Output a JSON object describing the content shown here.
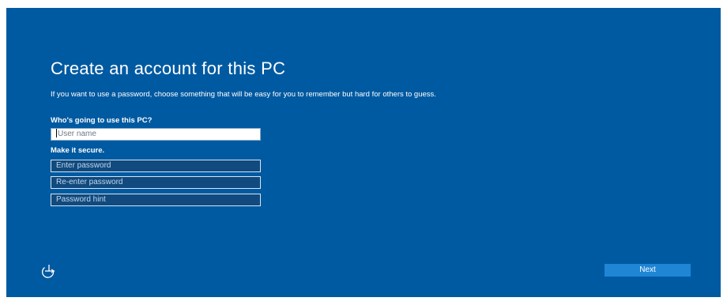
{
  "page": {
    "title": "Create an account for this PC",
    "description": "If you want to use a password, choose something that will be easy for you to remember but hard for others to guess."
  },
  "form": {
    "user_section_label": "Who's going to use this PC?",
    "username_placeholder": "User name",
    "secure_section_label": "Make it secure.",
    "password_placeholder": "Enter password",
    "reenter_password_placeholder": "Re-enter password",
    "password_hint_placeholder": "Password hint"
  },
  "footer": {
    "ease_of_access_icon": "ease-of-access-icon",
    "next_label": "Next"
  },
  "colors": {
    "background": "#005aa1",
    "button": "#1f86d6",
    "field_dark": "#104a7e"
  }
}
